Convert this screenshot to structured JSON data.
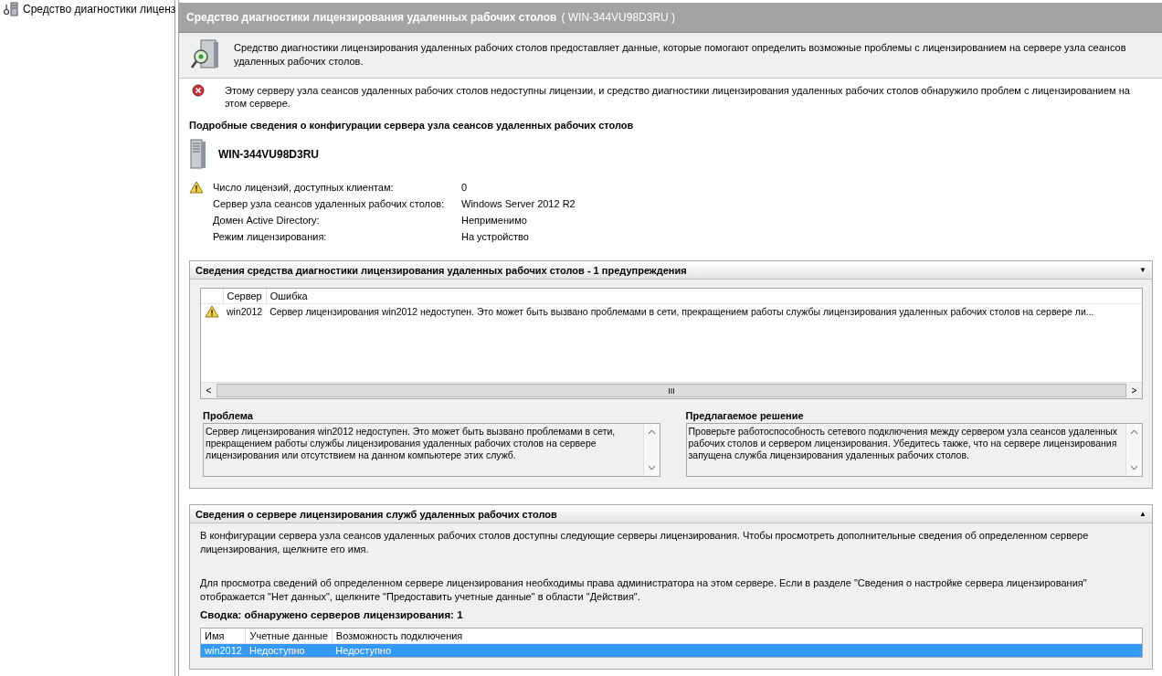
{
  "sidebar": {
    "items": [
      {
        "label": "Средство диагностики лиценз",
        "selected": false
      }
    ]
  },
  "header": {
    "title": "Средство диагностики лицензирования удаленных рабочих столов",
    "server": "( WIN-344VU98D3RU )"
  },
  "description": "Средство диагностики лицензирования удаленных рабочих столов предоставляет данные, которые помогают определить возможные проблемы с лицензированием на сервере узла сеансов удаленных рабочих столов.",
  "error_message": "Этому серверу узла сеансов удаленных рабочих столов недоступны лицензии, и средство диагностики лицензирования удаленных рабочих столов обнаружило проблем с лицензированием на этом сервере.",
  "config": {
    "heading": "Подробные сведения о конфигурации сервера узла сеансов удаленных рабочих столов",
    "server_name": "WIN-344VU98D3RU",
    "properties": [
      {
        "label": "Число лицензий, доступных клиентам:",
        "value": "0",
        "warning": true
      },
      {
        "label": "Сервер узла сеансов удаленных рабочих столов:",
        "value": "Windows Server 2012 R2",
        "warning": false
      },
      {
        "label": "Домен Active Directory:",
        "value": "Неприменимо",
        "warning": false
      },
      {
        "label": "Режим лицензирования:",
        "value": "На устройство",
        "warning": false
      }
    ]
  },
  "diagnostics": {
    "title": "Сведения средства диагностики лицензирования удаленных рабочих столов - 1 предупреждения",
    "caret": "▼",
    "table": {
      "columns": [
        "Сервер",
        "Ошибка"
      ],
      "rows": [
        {
          "warning": true,
          "selected": false,
          "cells": [
            "win2012",
            "Сервер лицензирования win2012 недоступен. Это может быть вызвано проблемами в сети, прекращением работы службы лицензирования удаленных рабочих столов на сервере ли..."
          ]
        }
      ]
    },
    "scrollbar": {
      "left": "<",
      "thumb": "III",
      "right": ">"
    },
    "problem": {
      "label": "Проблема",
      "text": "Сервер лицензирования win2012 недоступен. Это может быть вызвано проблемами в сети, прекращением работы службы лицензирования удаленных рабочих столов на сервере лицензирования или отсутствием на данном компьютере этих служб."
    },
    "solution": {
      "label": "Предлагаемое решение",
      "text": "Проверьте работоспособность сетевого подключения между сервером узла сеансов удаленных рабочих столов и сервером лицензирования. Убедитесь также, что на сервере лицензирования запущена служба лицензирования удаленных рабочих столов."
    }
  },
  "license_servers": {
    "title": "Сведения о сервере лицензирования служб удаленных рабочих столов",
    "caret": "▲",
    "intro": "В конфигурации сервера узла сеансов удаленных рабочих столов доступны следующие серверы лицензирования. Чтобы просмотреть дополнительные сведения об определенном сервере лицензирования, щелкните его имя.",
    "note": "Для просмотра сведений об определенном сервере лицензирования необходимы права администратора на этом сервере. Если в разделе \"Сведения о настройке сервера лицензирования\" отображается \"Нет данных\", щелкните \"Предоставить учетные данные\" в области \"Действия\".",
    "summary": "Сводка: обнаружено серверов лицензирования: 1",
    "table": {
      "columns": [
        "Имя",
        "Учетные данные",
        "Возможность подключения"
      ],
      "rows": [
        {
          "selected": true,
          "cells": [
            "win2012",
            "Недоступно",
            "Недоступно"
          ]
        }
      ]
    }
  }
}
